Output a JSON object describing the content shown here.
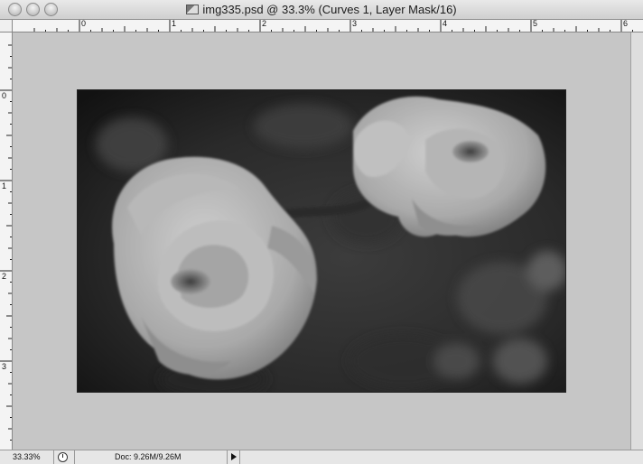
{
  "window": {
    "title": "img335.psd @ 33.3% (Curves 1, Layer Mask/16)"
  },
  "rulers": {
    "top_labels": [
      "0",
      "1",
      "2",
      "3",
      "4",
      "5",
      "6"
    ],
    "left_labels": [
      "0",
      "1",
      "2",
      "3"
    ]
  },
  "document": {
    "subject": "black-and-white photo of two roses"
  },
  "statusbar": {
    "zoom": "33.33%",
    "doc_size": "Doc: 9.26M/9.26M"
  }
}
